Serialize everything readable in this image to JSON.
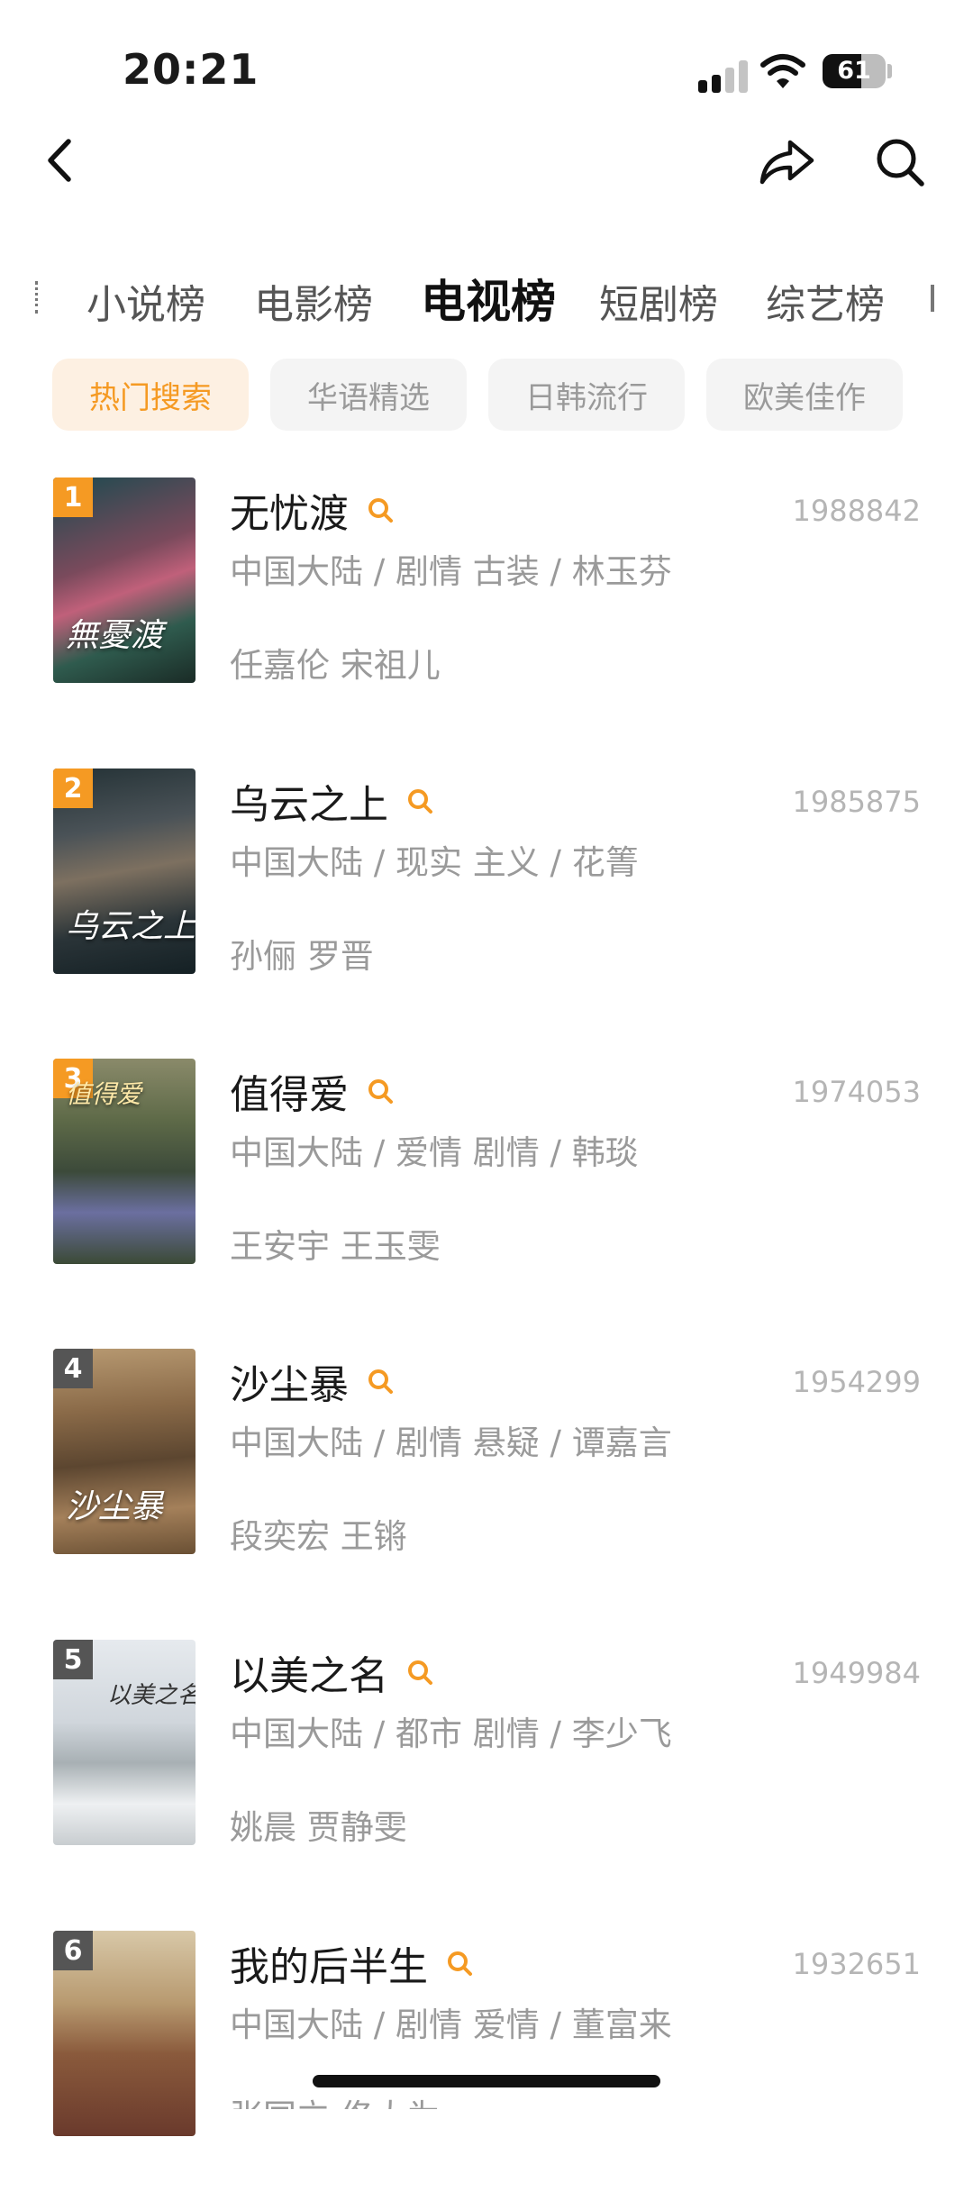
{
  "status_bar": {
    "time": "20:21",
    "battery": "61"
  },
  "nav": {
    "back_icon": "chevron-left-icon",
    "share_icon": "share-arrow-icon",
    "search_icon": "search-icon"
  },
  "tabs": [
    {
      "label": "小说榜",
      "active": false
    },
    {
      "label": "电影榜",
      "active": false
    },
    {
      "label": "电视榜",
      "active": true
    },
    {
      "label": "短剧榜",
      "active": false
    },
    {
      "label": "综艺榜",
      "active": false
    }
  ],
  "filters": [
    {
      "label": "热门搜索",
      "active": true
    },
    {
      "label": "华语精选",
      "active": false
    },
    {
      "label": "日韩流行",
      "active": false
    },
    {
      "label": "欧美佳作",
      "active": false
    }
  ],
  "colors": {
    "accent": "#f59a23",
    "accent_bg": "#fdf0e2",
    "rank_other": "#555555"
  },
  "items": [
    {
      "rank": "1",
      "title": "无忧渡",
      "count": "1988842",
      "meta": "中国大陆 / 剧情 古装 / 林玉芬",
      "cast": "任嘉伦 宋祖儿",
      "poster_text": "無憂渡"
    },
    {
      "rank": "2",
      "title": "乌云之上",
      "count": "1985875",
      "meta": "中国大陆 / 现实 主义 / 花箐",
      "cast": "孙俪 罗晋",
      "poster_text": "乌云之上"
    },
    {
      "rank": "3",
      "title": "值得爱",
      "count": "1974053",
      "meta": "中国大陆 / 爱情 剧情 / 韩琰",
      "cast": "王安宇 王玉雯",
      "poster_text": "值得爱"
    },
    {
      "rank": "4",
      "title": "沙尘暴",
      "count": "1954299",
      "meta": "中国大陆 / 剧情 悬疑 / 谭嘉言",
      "cast": "段奕宏 王锵",
      "poster_text": "沙尘暴"
    },
    {
      "rank": "5",
      "title": "以美之名",
      "count": "1949984",
      "meta": "中国大陆 / 都市 剧情 / 李少飞",
      "cast": "姚晨 贾静雯",
      "poster_text": "以美之名"
    },
    {
      "rank": "6",
      "title": "我的后半生",
      "count": "1932651",
      "meta": "中国大陆 / 剧情 爱情 / 董富来",
      "cast": "张国立 佟大为",
      "poster_text": ""
    }
  ]
}
